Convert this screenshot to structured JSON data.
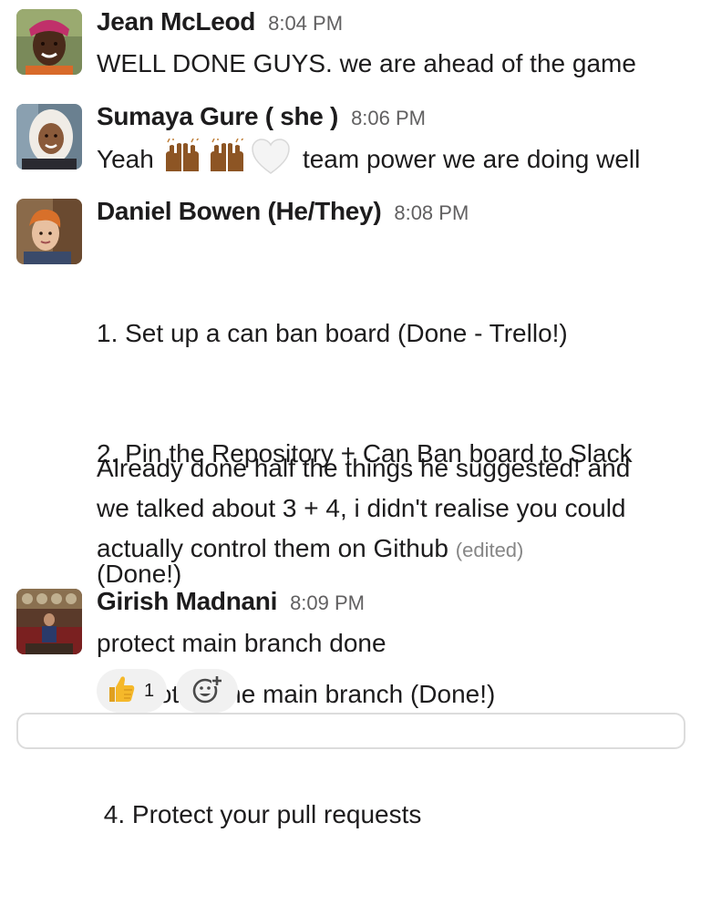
{
  "messages": [
    {
      "author": "Jean McLeod",
      "time": "8:04 PM",
      "lines": [
        "WELL DONE GUYS. we are ahead of the game"
      ]
    },
    {
      "author": "Sumaya Gure ( she )",
      "time": "8:06 PM",
      "text_before": "Yeah",
      "emojis": [
        "raised-hands-icon",
        "raised-hands-icon",
        "white-heart-icon"
      ],
      "text_after": "team power we are doing well"
    },
    {
      "author": "Daniel Bowen (He/They)",
      "time": "8:08 PM",
      "lines": [
        "1. Set up a can ban board (Done - Trello!)",
        "2. Pin the Repository + Can Ban board to Slack",
        "(Done!)",
        " 3. Protect the main branch (Done!)",
        " 4. Protect your pull requests"
      ],
      "followup_lines": [
        "Already done half the things he suggested! and",
        "we talked about 3 + 4, i didn't realise you could",
        "actually control them on Github"
      ],
      "edited_label": "(edited)"
    },
    {
      "author": "Girish Madnani",
      "time": "8:09 PM",
      "lines": [
        "protect main branch done"
      ]
    }
  ],
  "reactions": [
    {
      "icon": "thumbs-up-icon",
      "count": "1"
    }
  ],
  "add_reaction_icon": "add-reaction-icon",
  "colors": {
    "text": "#1d1c1d",
    "timestamp": "#616061",
    "edited": "#868686",
    "reaction_bg": "#f1f1f1"
  }
}
